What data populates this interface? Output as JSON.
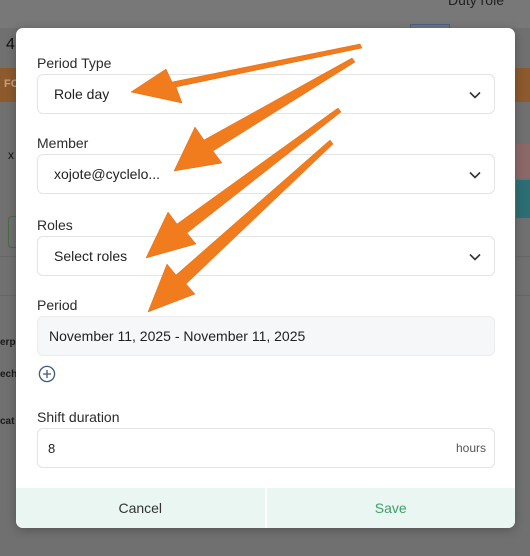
{
  "background": {
    "top_label": "Duty role",
    "number_fragment": "4",
    "orange_fragment": "FO",
    "row_fragment": "x",
    "label_fragment_1": "erp",
    "label_fragment_2": "ech",
    "label_fragment_3": "cat"
  },
  "form": {
    "period_type": {
      "label": "Period Type",
      "value": "Role day"
    },
    "member": {
      "label": "Member",
      "value": "xojote@cyclelo..."
    },
    "roles": {
      "label": "Roles",
      "value": "Select roles"
    },
    "period": {
      "label": "Period",
      "value": "November 11, 2025 - November 11, 2025"
    },
    "shift_duration": {
      "label": "Shift duration",
      "value": "8",
      "unit": "hours"
    }
  },
  "footer": {
    "cancel_label": "Cancel",
    "save_label": "Save"
  },
  "colors": {
    "accent_green": "#3fa06a",
    "footer_bg": "#eaf6f2",
    "annotation_arrow": "#f07c1e",
    "add_icon": "#3b5a80"
  }
}
